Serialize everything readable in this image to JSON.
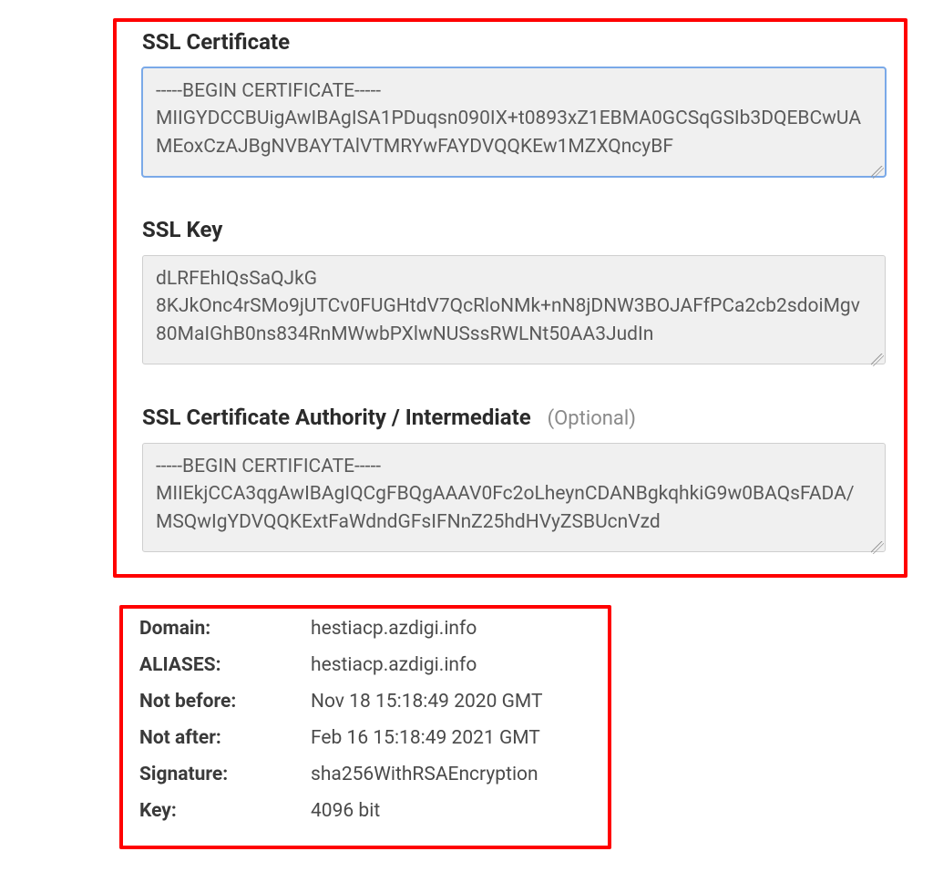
{
  "ssl": {
    "certificate": {
      "label": "SSL Certificate",
      "value": "-----BEGIN CERTIFICATE-----\nMIIGYDCCBUigAwIBAgISA1PDuqsn090IX+t0893xZ1EBMA0GCSqGSIb3DQEBCwUA\nMEoxCzAJBgNVBAYTAlVTMRYwFAYDVQQKEw1MZXQncyBF"
    },
    "key": {
      "label": "SSL Key",
      "value": "dLRFEhIQsSaQJkG\n8KJkOnc4rSMo9jUTCv0FUGHtdV7QcRloNMk+nN8jDNW3BOJAFfPCa2cb2sdoiMgv\n80MaIGhB0ns834RnMWwbPXlwNUSssRWLNt50AA3JudIn"
    },
    "ca": {
      "label": "SSL Certificate Authority / Intermediate",
      "optional_text": "(Optional)",
      "value": "-----BEGIN CERTIFICATE-----\nMIIEkjCCA3qgAwIBAgIQCgFBQgAAAV0Fc2oLheynCDANBgkqhkiG9w0BAQsFADA/\nMSQwIgYDVQQKExtFaWdndGFsIFNnZ25hdHVyZSBUcnVzd"
    }
  },
  "details": {
    "rows": [
      {
        "label": "Domain:",
        "value": "hestiacp.azdigi.info"
      },
      {
        "label": "ALIASES:",
        "value": "hestiacp.azdigi.info"
      },
      {
        "label": "Not before:",
        "value": "Nov 18 15:18:49 2020 GMT"
      },
      {
        "label": "Not after:",
        "value": "Feb 16 15:18:49 2021 GMT"
      },
      {
        "label": "Signature:",
        "value": "sha256WithRSAEncryption"
      },
      {
        "label": "Key:",
        "value": "4096 bit"
      }
    ]
  }
}
